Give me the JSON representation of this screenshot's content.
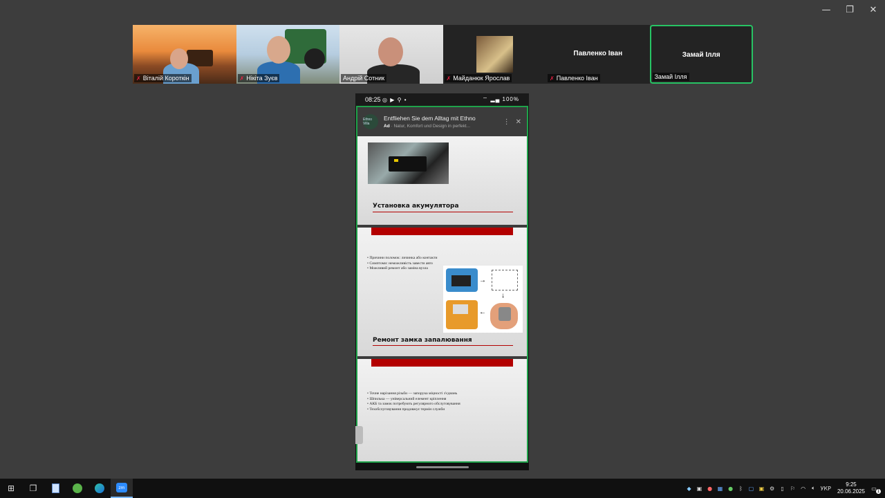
{
  "window_controls": {
    "minimize": "—",
    "restore": "❐",
    "close": "✕"
  },
  "participants": [
    {
      "name": "Віталій Короткін",
      "muted": true
    },
    {
      "name": "Нікіта Зуєв",
      "muted": true
    },
    {
      "name": "Андрій Сотник",
      "muted": false
    },
    {
      "name": "Майданюк Ярослав",
      "muted": true
    },
    {
      "name": "Павленко Іван",
      "muted": true,
      "center_label": "Павленко Іван"
    },
    {
      "name": "Замай Ілля",
      "muted": false,
      "center_label": "Замай Ілля",
      "active": true
    }
  ],
  "phone": {
    "time": "08:25",
    "status_icons": "◎ ▶ ⚲ •",
    "battery": "100%",
    "ad": {
      "logo_text": "Ethno Villa",
      "headline": "Entfliehen Sie dem Alltag mit Ethno",
      "label": "Ad",
      "subline": "· Natur, Komfort und Design in perfekt..."
    },
    "slides": [
      {
        "title": "Установка акумулятора"
      },
      {
        "title": "Ремонт замка запалювання",
        "bullets": [
          "• Причини поломок: личинка або контакти",
          "• Симптоми: неможливість завести авто",
          "• Можливий ремонт або заміна вузла"
        ]
      },
      {
        "bullets": [
          "• Точне нарізання різьби — запорука міцності з'єднань",
          "• Шпилька — універсальний елемент кріплення",
          "• АКБ та замок потребують регулярного обслуговування",
          "• Техобслуговування продовжує термін служби"
        ]
      }
    ]
  },
  "taskbar": {
    "language": "УКР",
    "time": "9:25",
    "date": "20.06.2025",
    "notifications": "1",
    "zoom_label": "zm"
  },
  "colors": {
    "active_border": "#27c464",
    "phone_border": "#1fa34a",
    "slide_red": "#b30000"
  }
}
